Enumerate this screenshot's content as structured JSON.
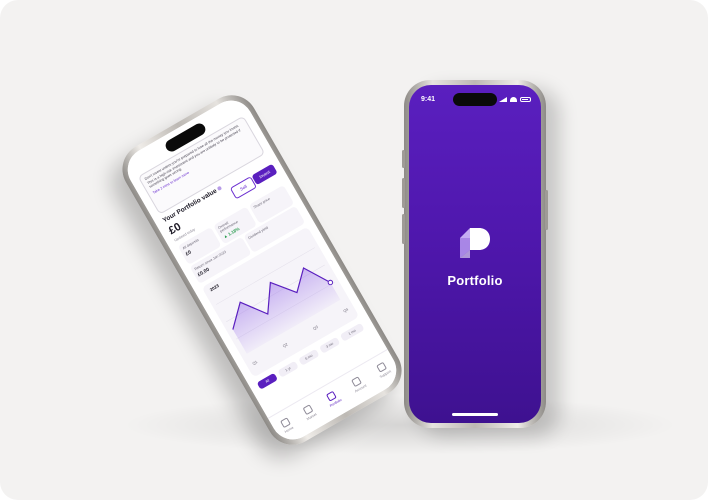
{
  "splash": {
    "status_time": "9:41",
    "app_name": "Portfolio",
    "logo_icon": "portfolio-logo-icon",
    "bg_color": "#5a1fbf"
  },
  "portfolio_screen": {
    "notice_text": "Don't invest unless you're prepared to lose all the money you invest. This is a high-risk investment and you are unlikely to be protected if something goes wrong.",
    "notice_link": "Take 2 mins to learn more",
    "title": "Your Portfolio value",
    "value": "£0",
    "value_sub": "Updated today",
    "sell_label": "Sell",
    "invest_label": "Invest",
    "tiles": [
      {
        "label": "All deposits",
        "value": "£0"
      },
      {
        "label": "Overall performance",
        "value": "▲ 1.18%"
      },
      {
        "label": "Share price",
        "value": ""
      },
      {
        "label": "Dividend yield",
        "value": ""
      }
    ],
    "stat_label": "Return since Jan 2023",
    "stat_value": "£0.00",
    "filters": [
      "All",
      "1 yr",
      "6 mo",
      "3 mo",
      "1 mo"
    ],
    "chart_year": "2023",
    "quarters": [
      "Q1",
      "Q2",
      "Q3",
      "Q4"
    ],
    "tabs": [
      "Home",
      "Market",
      "Portfolio",
      "Account",
      "Support"
    ],
    "accent": "#5a1fbf"
  }
}
